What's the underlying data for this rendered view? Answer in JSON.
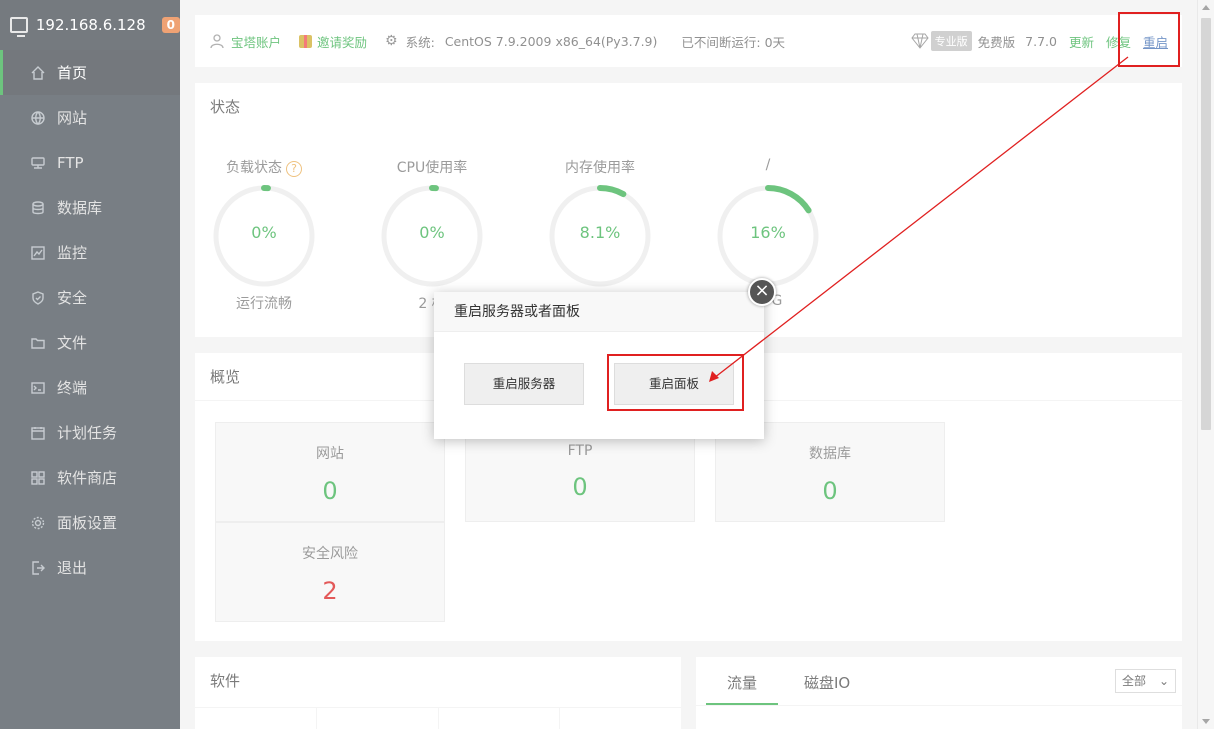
{
  "sidebar": {
    "host": "192.168.6.128",
    "badge": "0",
    "items": [
      {
        "label": "首页",
        "icon": "home-icon",
        "active": true
      },
      {
        "label": "网站",
        "icon": "globe-icon"
      },
      {
        "label": "FTP",
        "icon": "ftp-icon"
      },
      {
        "label": "数据库",
        "icon": "database-icon"
      },
      {
        "label": "监控",
        "icon": "monitor-chart-icon"
      },
      {
        "label": "安全",
        "icon": "shield-icon"
      },
      {
        "label": "文件",
        "icon": "folder-icon"
      },
      {
        "label": "终端",
        "icon": "terminal-icon"
      },
      {
        "label": "计划任务",
        "icon": "calendar-icon"
      },
      {
        "label": "软件商店",
        "icon": "grid-icon"
      },
      {
        "label": "面板设置",
        "icon": "gear-icon"
      },
      {
        "label": "退出",
        "icon": "logout-icon"
      }
    ]
  },
  "topbar": {
    "account": "宝塔账户",
    "invite": "邀请奖励",
    "system_label": "系统:",
    "system_value": "CentOS 7.9.2009 x86_64(Py3.7.9)",
    "uptime": "已不间断运行: 0天",
    "pro": "专业版",
    "free": "免费版",
    "version": "7.7.0",
    "update": "更新",
    "repair": "修复",
    "restart": "重启"
  },
  "status": {
    "title": "状态",
    "gauges": [
      {
        "title": "负载状态",
        "value": "0%",
        "sub": "运行流畅",
        "percent": 0.01
      },
      {
        "title": "CPU使用率",
        "value": "0%",
        "sub": "2 核",
        "percent": 0.01
      },
      {
        "title": "内存使用率",
        "value": "8.1%",
        "sub": "",
        "percent": 0.081
      },
      {
        "title": "/",
        "value": "16%",
        "sub": "17G",
        "percent": 0.16
      }
    ]
  },
  "overview": {
    "title": "概览",
    "boxes": [
      {
        "label": "网站",
        "value": "0"
      },
      {
        "label": "FTP",
        "value": "0"
      },
      {
        "label": "数据库",
        "value": "0"
      },
      {
        "label": "安全风险",
        "value": "2"
      }
    ]
  },
  "software": {
    "title": "软件"
  },
  "traffic": {
    "tabs": [
      "流量",
      "磁盘IO"
    ],
    "select": "全部"
  },
  "dialog": {
    "title": "重启服务器或者面板",
    "btn_server": "重启服务器",
    "btn_panel": "重启面板",
    "close": "×"
  },
  "colors": {
    "accent": "#20a53a",
    "sidebar": "#313a42",
    "danger": "#d40000",
    "annotation": "#e02020"
  }
}
